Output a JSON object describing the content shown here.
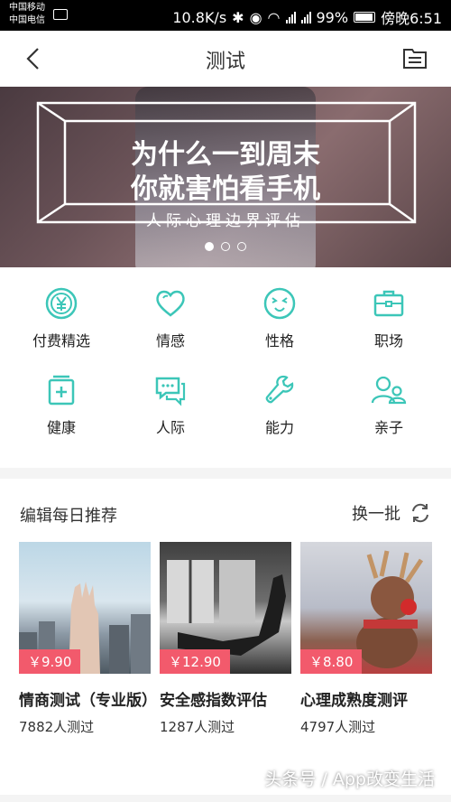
{
  "status": {
    "carrier1": "中国移动",
    "carrier2": "中国电信",
    "speed": "10.8K/s",
    "battery": "99%",
    "time": "傍晚6:51"
  },
  "nav": {
    "title": "测试"
  },
  "banner": {
    "line1": "为什么一到周末",
    "line2": "你就害怕看手机",
    "sub": "人际心理边界评估",
    "slides": 3,
    "active_slide": 1
  },
  "categories": [
    {
      "label": "付费精选",
      "icon": "yen-coin-icon"
    },
    {
      "label": "情感",
      "icon": "heart-icon"
    },
    {
      "label": "性格",
      "icon": "face-icon"
    },
    {
      "label": "职场",
      "icon": "briefcase-icon"
    },
    {
      "label": "健康",
      "icon": "medical-kit-icon"
    },
    {
      "label": "人际",
      "icon": "chat-bubbles-icon"
    },
    {
      "label": "能力",
      "icon": "wrench-icon"
    },
    {
      "label": "亲子",
      "icon": "parent-child-icon"
    }
  ],
  "recommend": {
    "heading": "编辑每日推荐",
    "refresh_label": "换一批",
    "cards": [
      {
        "price": "￥9.90",
        "title": "情商测试（专业版）",
        "count": "7882人测过"
      },
      {
        "price": "￥12.90",
        "title": "安全感指数评估",
        "count": "1287人测过"
      },
      {
        "price": "￥8.80",
        "title": "心理成熟度测评",
        "count": "4797人测过"
      }
    ]
  },
  "watermark": "头条号 / App改变生活",
  "colors": {
    "accent": "#3cc6b8",
    "price_badge": "#f25a6c"
  }
}
